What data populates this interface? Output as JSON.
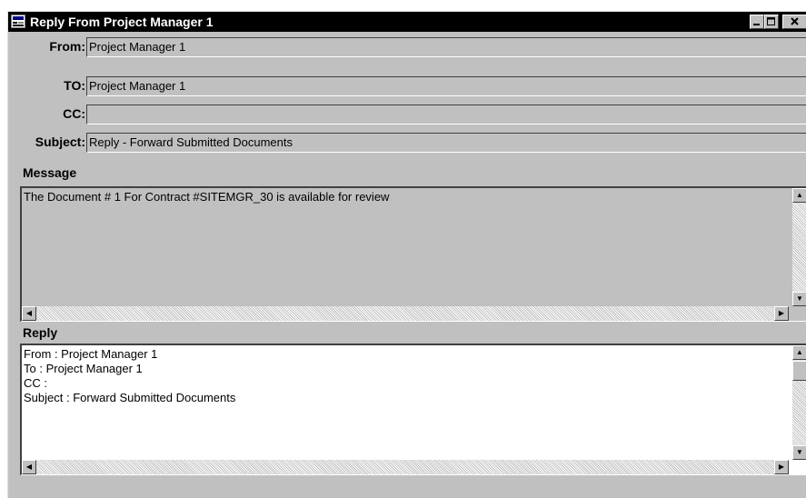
{
  "window": {
    "title": "Reply From Project Manager 1",
    "controls": {
      "minimize_icon": "minimize-icon",
      "maximize_icon": "maximize-icon",
      "close_icon": "close-icon"
    }
  },
  "header": {
    "from_label": "From:",
    "from_value": "Project Manager 1",
    "to_label": "TO:",
    "to_value": "Project Manager 1",
    "cc_label": "CC:",
    "cc_value": "",
    "subject_label": "Subject:",
    "subject_value": "Reply - Forward Submitted Documents"
  },
  "message": {
    "label": "Message",
    "text": "The Document #  1 For Contract #SITEMGR_30 is available for review"
  },
  "reply": {
    "label": "Reply",
    "text": "From : Project Manager 1\nTo : Project Manager 1\nCC :\nSubject : Forward Submitted Documents"
  },
  "icons": {
    "scroll_left": "◀",
    "scroll_right": "▶",
    "scroll_up": "▲",
    "scroll_down": "▼"
  },
  "colors": {
    "titlebar": "#000000",
    "window_face": "#c0c0c0",
    "reply_background": "#ffffff"
  }
}
